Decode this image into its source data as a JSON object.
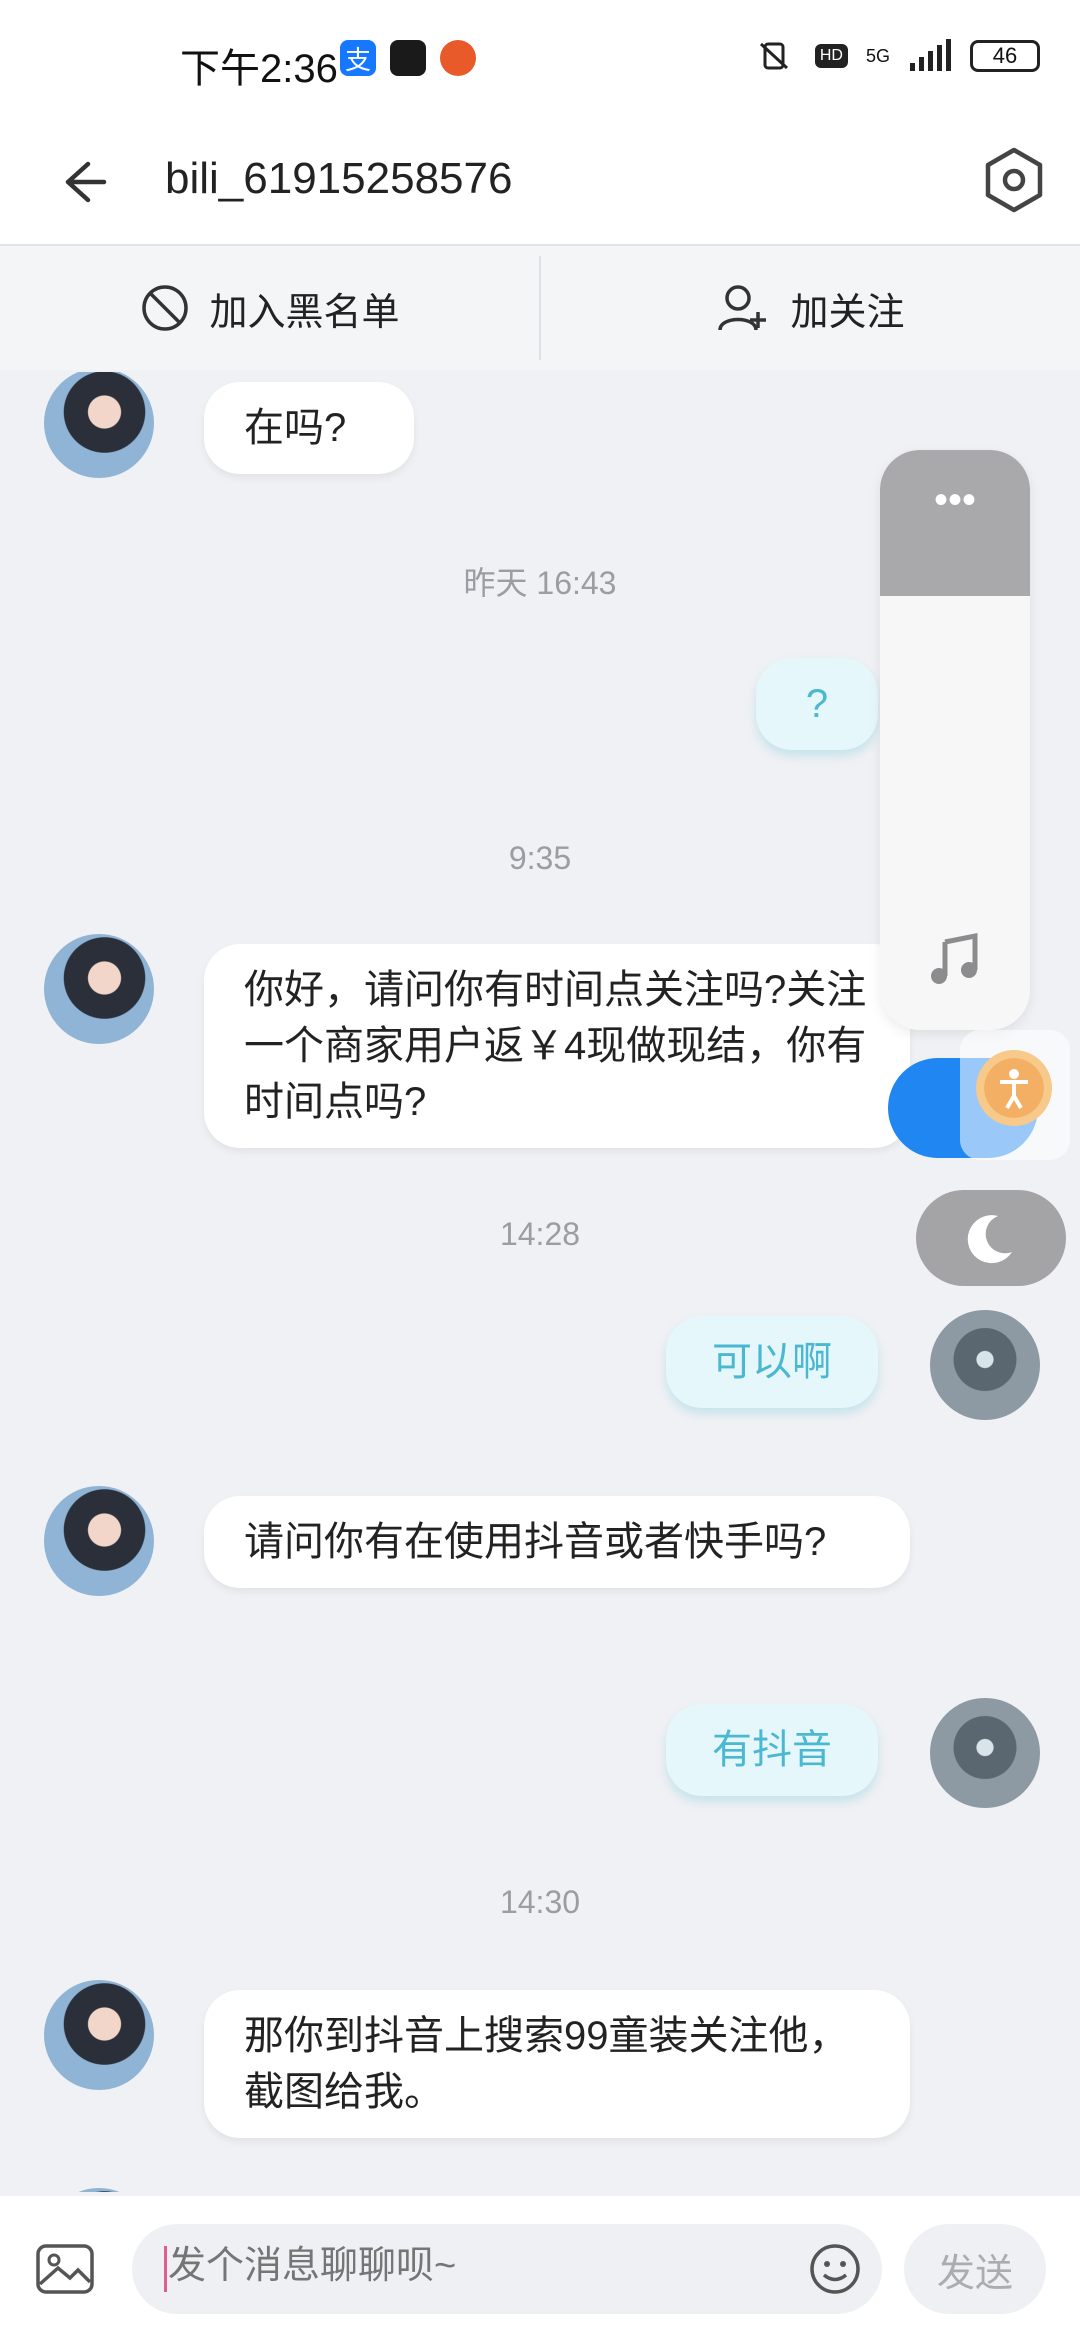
{
  "status_bar": {
    "time": "下午2:36",
    "hd_label": "HD",
    "network": "5G",
    "battery": "46",
    "app_icons": [
      "alipay-icon",
      "tiktok-lite-icon",
      "pumpkin-icon"
    ]
  },
  "header": {
    "title": "bili_61915258576",
    "back_icon": "arrow-left-icon",
    "settings_icon": "hexagon-settings-icon"
  },
  "actions": {
    "blacklist_label": "加入黑名单",
    "follow_label": "加关注"
  },
  "messages": [
    {
      "side": "left",
      "text": "在吗?"
    },
    {
      "type": "timestamp",
      "text": "昨天 16:43"
    },
    {
      "side": "right",
      "text": "?"
    },
    {
      "type": "timestamp",
      "text": "9:35"
    },
    {
      "side": "left",
      "text": "你好，请问你有时间点关注吗?关注一个商家用户返￥4现做现结，你有时间点吗?"
    },
    {
      "type": "timestamp",
      "text": "14:28"
    },
    {
      "side": "right",
      "text": "可以啊"
    },
    {
      "side": "left",
      "text": "请问你有在使用抖音或者快手吗?"
    },
    {
      "side": "right",
      "text": "有抖音"
    },
    {
      "type": "timestamp",
      "text": "14:30"
    },
    {
      "side": "left",
      "text": "那你到抖音上搜索99童装关注他，截图给我。"
    }
  ],
  "floating": {
    "menu_dots": "•••",
    "music_icon": "music-note-icon",
    "moon_icon": "moon-icon",
    "accessibility_icon": "accessibility-icon"
  },
  "input": {
    "placeholder": "发个消息聊聊呗~",
    "send_label": "发送"
  },
  "colors": {
    "right_bubble_bg": "#e6f7fb",
    "right_bubble_text": "#4ab8d0",
    "toggle_blue": "#1f86f2"
  }
}
